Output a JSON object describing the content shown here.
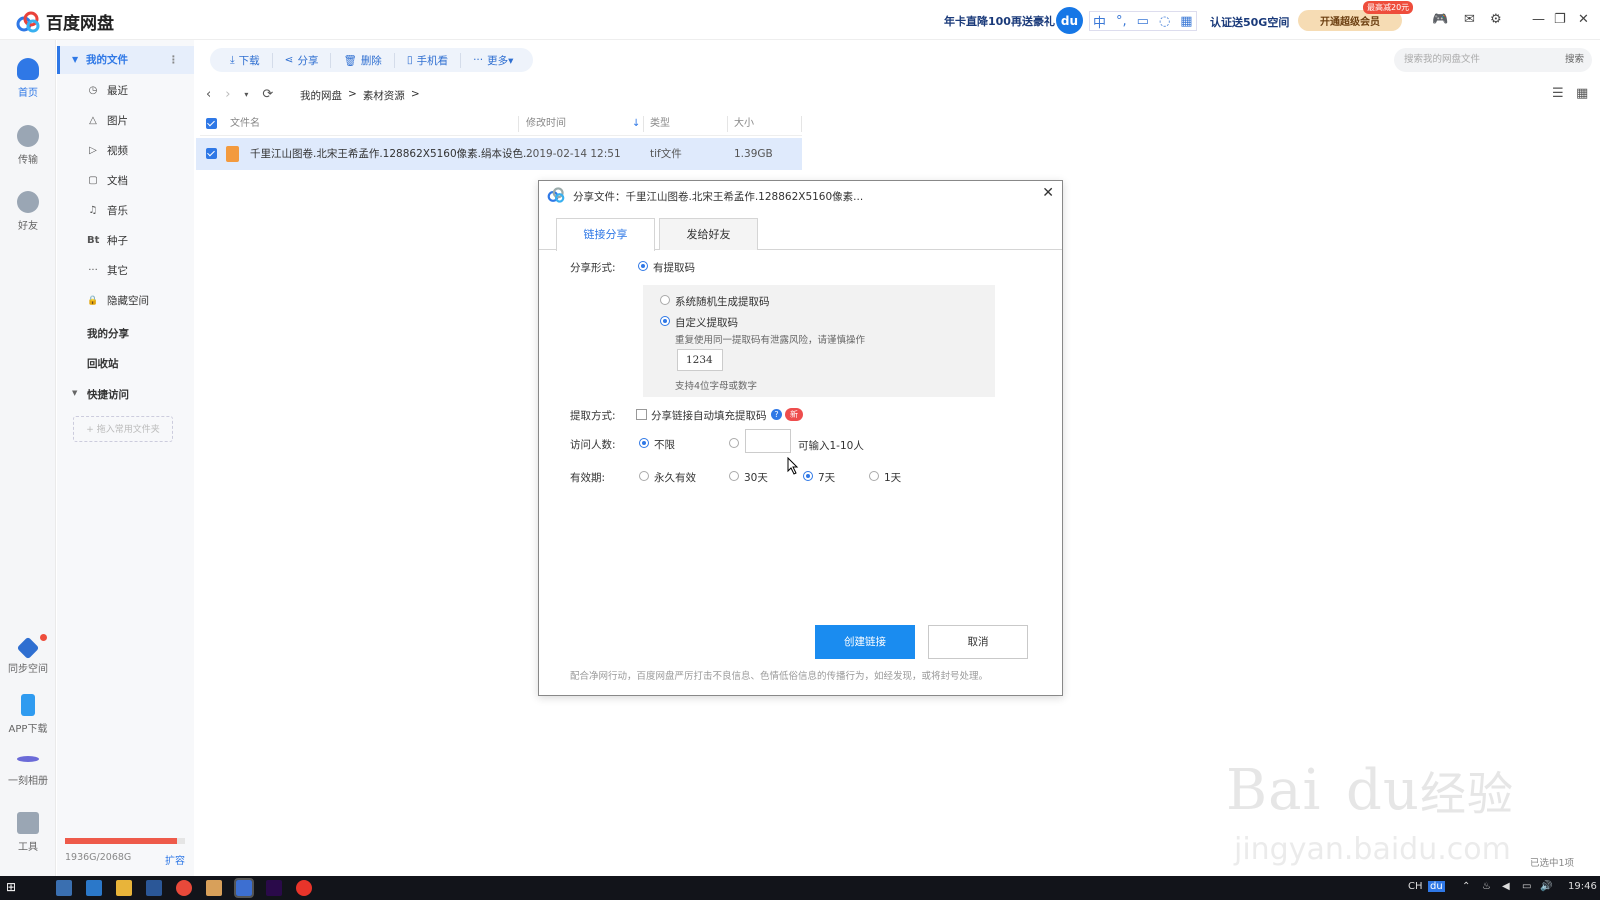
{
  "app": {
    "title": "百度网盘"
  },
  "topbar": {
    "promo": "年卡直降100再送豪礼",
    "du_label": "du",
    "ime_labels": [
      "中",
      "°,",
      "▭",
      "◌",
      "▦"
    ],
    "certify": "认证送50G空间",
    "vip_button": "开通超级会员",
    "vip_badge": "最高减20元"
  },
  "rail": [
    {
      "label": "首页",
      "active": true
    },
    {
      "label": "传输",
      "active": false
    },
    {
      "label": "好友",
      "active": false
    },
    {
      "label": "同步空间",
      "active": false
    },
    {
      "label": "APP下载",
      "active": false
    },
    {
      "label": "一刻相册",
      "active": false
    },
    {
      "label": "工具",
      "active": false
    }
  ],
  "sidebar": {
    "my_files": "我的文件",
    "items": [
      {
        "label": "最近",
        "icon": "◷"
      },
      {
        "label": "图片",
        "icon": "△"
      },
      {
        "label": "视频",
        "icon": "▷"
      },
      {
        "label": "文档",
        "icon": "▢"
      },
      {
        "label": "音乐",
        "icon": "♫"
      },
      {
        "label": "种子",
        "icon": "Bt"
      },
      {
        "label": "其它",
        "icon": "···"
      },
      {
        "label": "隐藏空间",
        "icon": "🔒"
      }
    ],
    "my_share": "我的分享",
    "recycle": "回收站",
    "quick_access": "快捷访问",
    "add_folder": "+ 拖入常用文件夹",
    "quota_text": "1936G/2068G",
    "quota_fraction": 0.936,
    "expand": "扩容"
  },
  "toolbar": {
    "download": "下载",
    "share": "分享",
    "delete": "删除",
    "phone": "手机看",
    "more": "更多▾"
  },
  "search": {
    "placeholder": "搜索我的网盘文件",
    "button": "搜索"
  },
  "breadcrumb": [
    "我的网盘",
    ">",
    "素材资源",
    ">"
  ],
  "table": {
    "headers": {
      "name": "文件名",
      "modified": "修改时间",
      "type": "类型",
      "size": "大小"
    },
    "rows": [
      {
        "name": "千里江山图卷.北宋王希孟作.128862X5160像素.绢本设色...",
        "modified": "2019-02-14 12:51",
        "type": "tif文件",
        "size": "1.39GB"
      }
    ]
  },
  "dialog": {
    "title": "分享文件：千里江山图卷.北宋王希孟作.128862X5160像素...",
    "tabs": [
      "链接分享",
      "发给好友"
    ],
    "share_form_label": "分享形式:",
    "share_form_value": "有提取码",
    "random_code": "系统随机生成提取码",
    "custom_code": "自定义提取码",
    "custom_warning": "重复使用同一提取码有泄露风险，请谨慎操作",
    "code_value": "1234",
    "code_hint": "支持4位字母或数字",
    "method_label": "提取方式:",
    "method_option": "分享链接自动填充提取码",
    "new_badge": "新",
    "visitors_label": "访问人数:",
    "visitors_unlimited": "不限",
    "visitors_hint": "可输入1-10人",
    "validity_label": "有效期:",
    "validity_options": [
      "永久有效",
      "30天",
      "7天",
      "1天"
    ],
    "create_button": "创建链接",
    "cancel_button": "取消",
    "notice": "配合净网行动，百度网盘严厉打击不良信息、色情低俗信息的传播行为，如经发现，或将封号处理。"
  },
  "status": {
    "selected": "已选中1项"
  },
  "taskbar": {
    "time": "19:46",
    "lang": "CH",
    "du": "du"
  },
  "watermark": {
    "text1": "Bai",
    "text2": "du",
    "text3": "经验",
    "url": "jingyan.baidu.com"
  },
  "colors": {
    "accent": "#2f78e6",
    "primary_button": "#1a8cf0",
    "quota": "#ee5a4a"
  }
}
